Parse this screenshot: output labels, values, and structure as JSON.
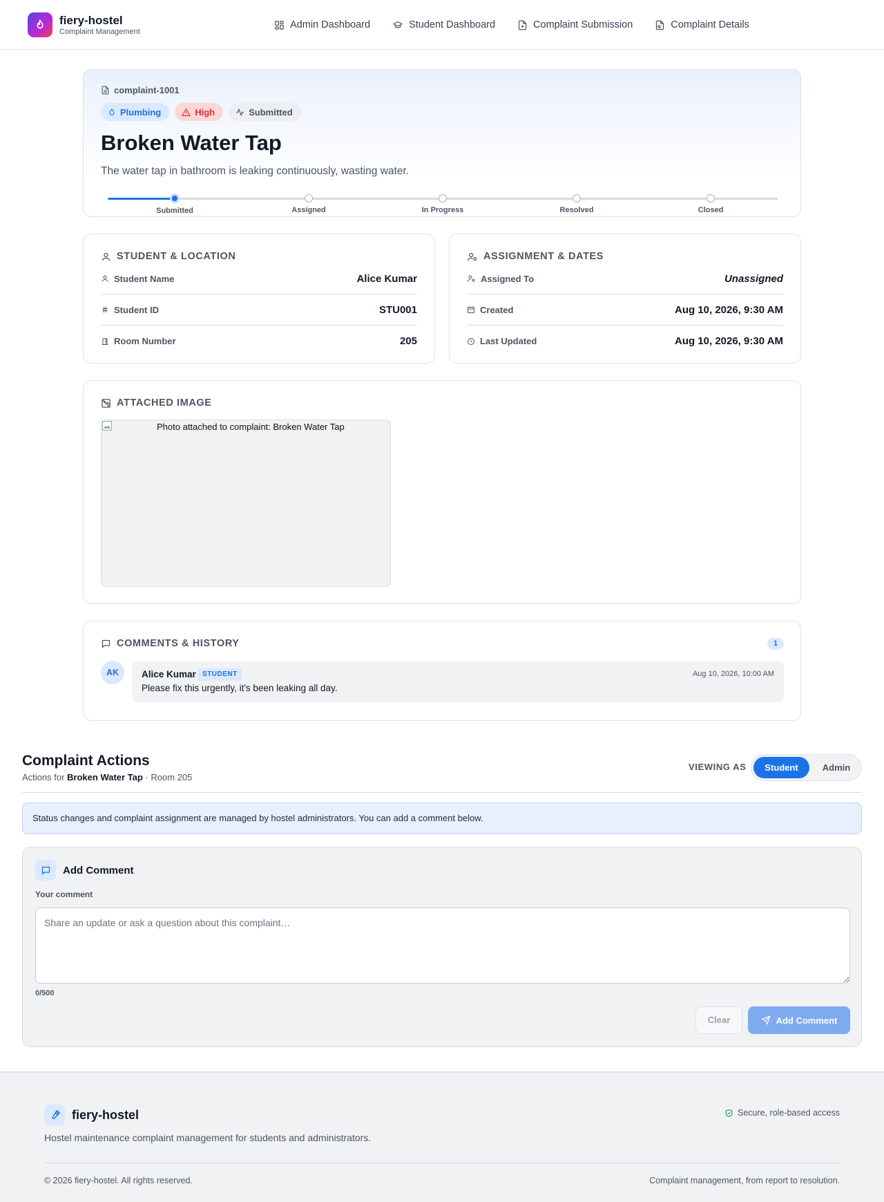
{
  "app": {
    "name": "fiery-hostel",
    "subtitle": "Complaint Management"
  },
  "nav": {
    "items": [
      {
        "label": "Admin Dashboard",
        "icon": "dashboard-icon"
      },
      {
        "label": "Student Dashboard",
        "icon": "graduation-cap-icon"
      },
      {
        "label": "Complaint Submission",
        "icon": "file-plus-icon"
      },
      {
        "label": "Complaint Details",
        "icon": "file-search-icon"
      }
    ]
  },
  "complaint": {
    "id": "complaint-1001",
    "category": "Plumbing",
    "priority": "High",
    "status": "Submitted",
    "title": "Broken Water Tap",
    "description": "The water tap in bathroom is leaking continuously, wasting water.",
    "progress_steps": [
      "Submitted",
      "Assigned",
      "In Progress",
      "Resolved",
      "Closed"
    ],
    "current_step_index": 0
  },
  "student_section": {
    "title": "STUDENT & LOCATION",
    "rows": [
      {
        "label": "Student Name",
        "value": "Alice Kumar",
        "icon": "user-icon"
      },
      {
        "label": "Student ID",
        "value": "STU001",
        "icon": "hash-icon"
      },
      {
        "label": "Room Number",
        "value": "205",
        "icon": "door-icon"
      }
    ]
  },
  "assignment_section": {
    "title": "ASSIGNMENT & DATES",
    "rows": [
      {
        "label": "Assigned To",
        "value": "Unassigned",
        "icon": "user-cog-icon"
      },
      {
        "label": "Created",
        "value": "Aug 10, 2026, 9:30 AM",
        "icon": "calendar-icon"
      },
      {
        "label": "Last Updated",
        "value": "Aug 10, 2026, 9:30 AM",
        "icon": "clock-icon"
      }
    ]
  },
  "image_section": {
    "title": "ATTACHED IMAGE",
    "alt_text": "Photo attached to complaint: Broken Water Tap"
  },
  "comments_section": {
    "title": "COMMENTS & HISTORY",
    "count": "1",
    "comments": [
      {
        "initials": "AK",
        "author": "Alice Kumar",
        "role": "STUDENT",
        "time": "Aug 10, 2026, 10:00 AM",
        "text": "Please fix this urgently, it's been leaking all day."
      }
    ]
  },
  "actions": {
    "title": "Complaint Actions",
    "subtitle_prefix": "Actions for",
    "subtitle_title": "Broken Water Tap",
    "subtitle_room": "· Room 205",
    "viewing_as_label": "VIEWING AS",
    "roles": [
      "Student",
      "Admin"
    ],
    "selected_role": "Student",
    "notice": "Status changes and complaint assignment are managed by hostel administrators. You can add a comment below."
  },
  "comment_form": {
    "title": "Add Comment",
    "label": "Your comment",
    "value": "",
    "placeholder": "Share an update or ask a question about this complaint…",
    "char_count": "0/500",
    "clear_label": "Clear",
    "submit_label": "Add Comment"
  },
  "footer": {
    "brand": "fiery-hostel",
    "secure": "Secure, role-based access",
    "description": "Hostel maintenance complaint management for students and administrators.",
    "copyright": "© 2026 fiery-hostel. All rights reserved.",
    "tagline": "Complaint management, from report to resolution."
  },
  "colors": {
    "accent": "#1a73e8",
    "priority_high": "#e03131",
    "secure_green": "#16a34a"
  }
}
